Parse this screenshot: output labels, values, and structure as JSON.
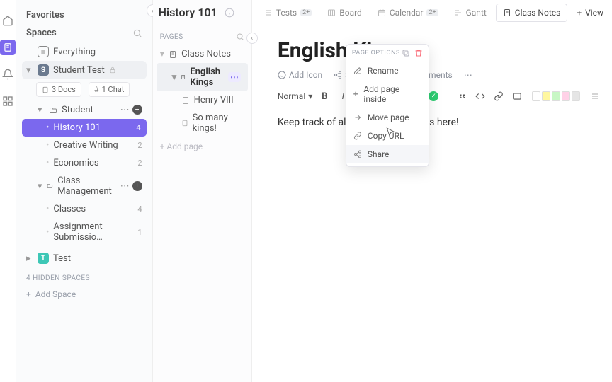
{
  "rail": {
    "home": "home-icon",
    "doc": "doc-icon",
    "bell": "bell-icon",
    "apps": "apps-icon"
  },
  "sidebar": {
    "favorites_title": "Favorites",
    "spaces_title": "Spaces",
    "everything_label": "Everything",
    "student_space": {
      "label": "Student Test",
      "initial": "S"
    },
    "docs_chip": "3 Docs",
    "chat_chip": "1 Chat",
    "student_folder": "Student",
    "student_items": [
      {
        "label": "History 101",
        "count": "4"
      },
      {
        "label": "Creative Writing",
        "count": "2"
      },
      {
        "label": "Economics",
        "count": "2"
      }
    ],
    "class_mgmt": "Class Management",
    "class_items": [
      {
        "label": "Classes",
        "count": "4"
      },
      {
        "label": "Assignment Submissio…",
        "count": "1"
      }
    ],
    "test_space": {
      "label": "Test",
      "initial": "T"
    },
    "hidden_label": "4 HIDDEN SPACES",
    "add_space": "Add Space"
  },
  "breadcrumb": {
    "title": "History 101"
  },
  "tabs": [
    {
      "name": "tests",
      "label": "Tests",
      "badge": "2+",
      "icon": "list-icon"
    },
    {
      "name": "board",
      "label": "Board",
      "icon": "board-icon"
    },
    {
      "name": "calendar",
      "label": "Calendar",
      "badge": "2+",
      "icon": "calendar-icon"
    },
    {
      "name": "gantt",
      "label": "Gantt",
      "icon": "gantt-icon"
    },
    {
      "name": "classnotes",
      "label": "Class Notes",
      "icon": "doc-icon",
      "active": true
    },
    {
      "name": "addview",
      "label": "View"
    }
  ],
  "pages": {
    "title": "PAGES",
    "items": [
      {
        "label": "Class Notes",
        "level": 1
      },
      {
        "label": "English Kings",
        "level": 2,
        "active": true
      },
      {
        "label": "Henry VIII",
        "level": 3
      },
      {
        "label": "So many kings!",
        "level": 3
      }
    ],
    "add_label": "+ Add page"
  },
  "context_menu": {
    "header": "PAGE OPTIONS",
    "items": [
      "Rename",
      "Add page inside",
      "Move page",
      "Copy URL",
      "Share"
    ]
  },
  "doc": {
    "title": "English Kings",
    "actions": {
      "add_icon": "Add Icon",
      "share": "Share Page",
      "comments": "Comments"
    },
    "style_label": "Normal",
    "body": "Keep track of all of your class notes here!",
    "swatches": [
      "#ffffff",
      "#fff7a0",
      "#c8f7c5",
      "#ffd1e7",
      "#e5e5e5"
    ]
  }
}
